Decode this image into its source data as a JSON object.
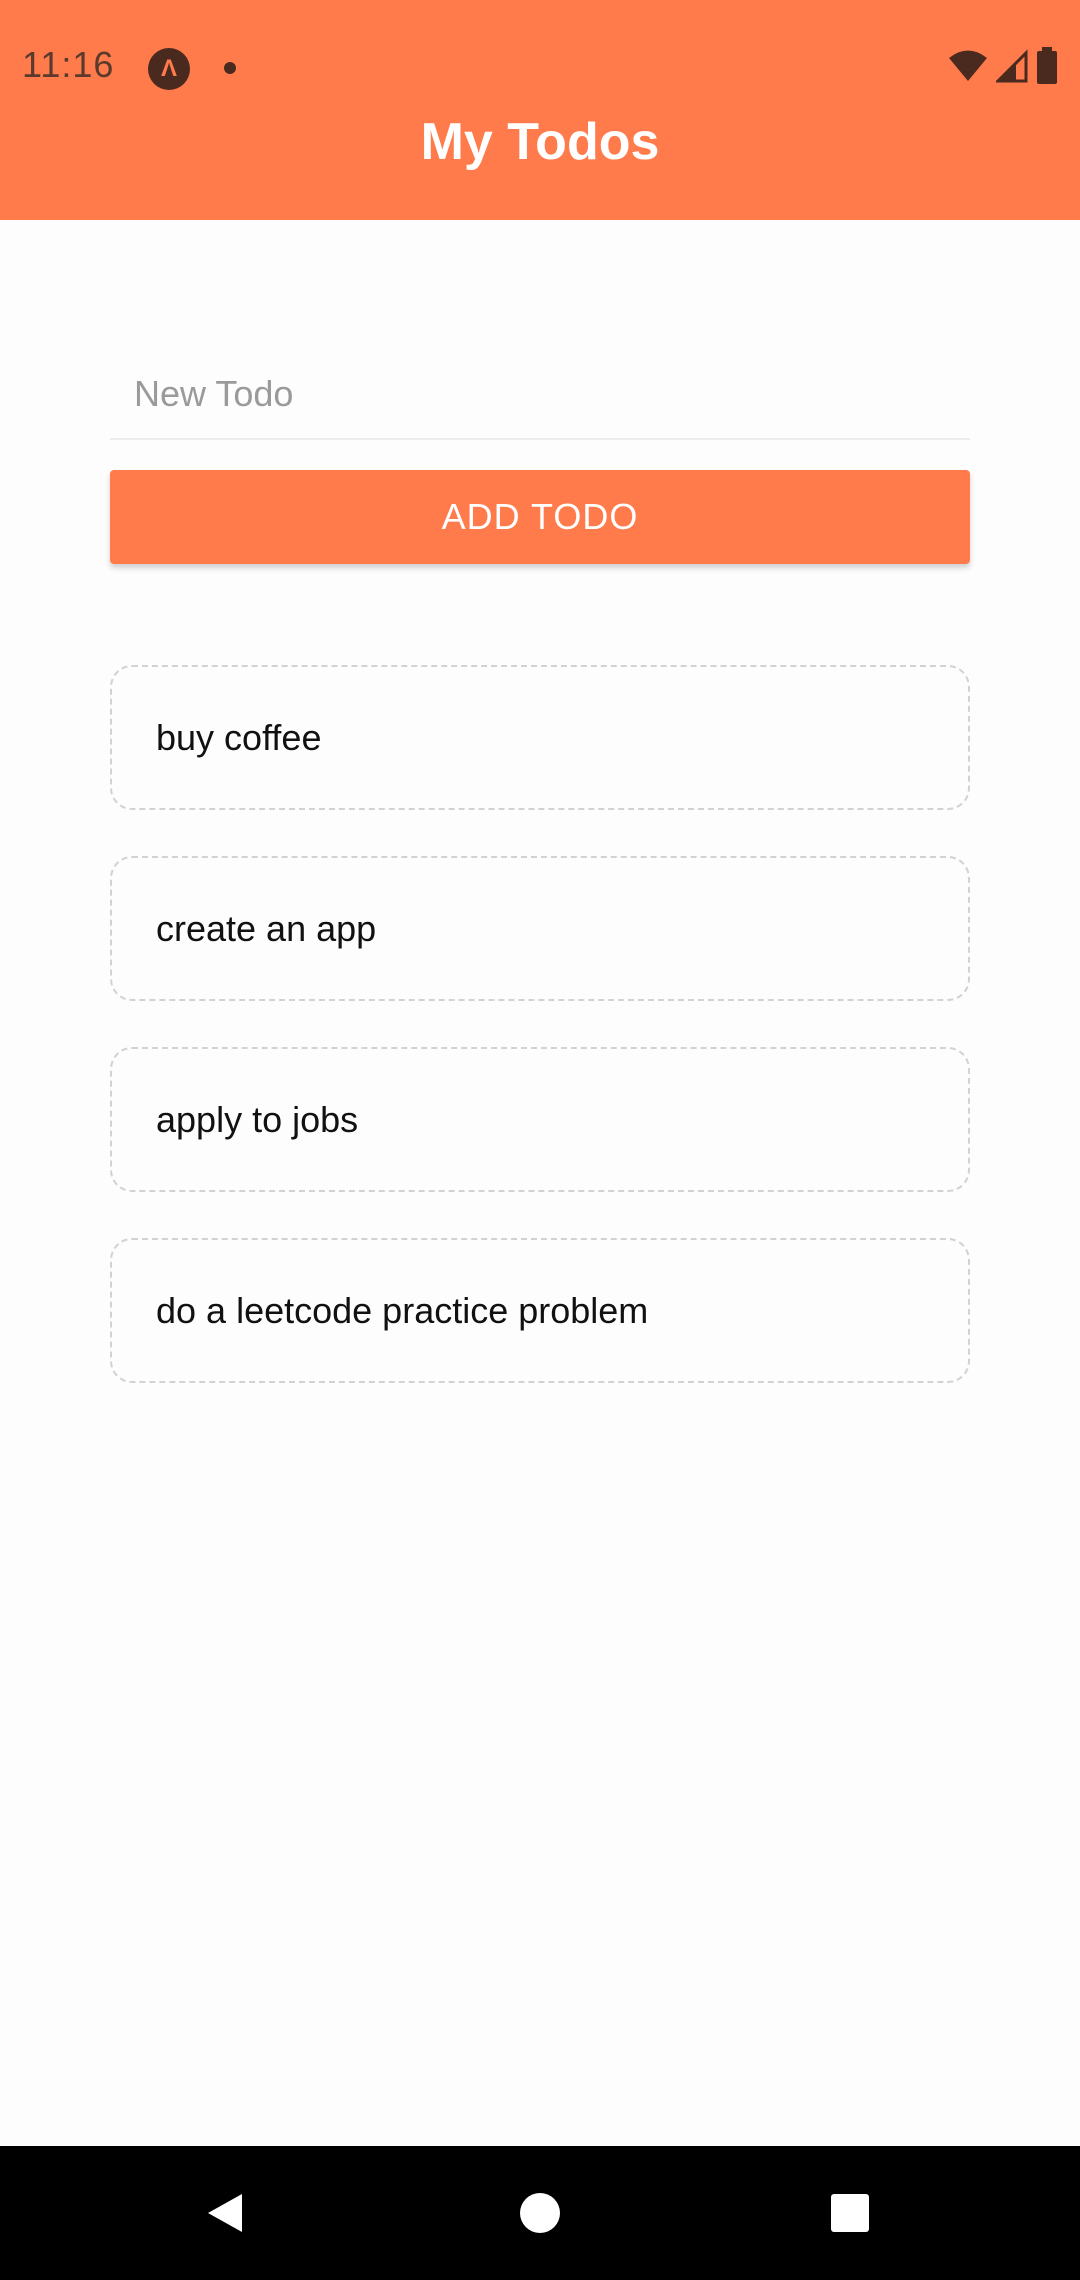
{
  "status_bar": {
    "time": "11:16",
    "app_icon_glyph": "Λ"
  },
  "header": {
    "title": "My Todos"
  },
  "input": {
    "placeholder": "New Todo",
    "value": ""
  },
  "add_button": {
    "label": "ADD TODO"
  },
  "todos": [
    {
      "text": "buy coffee"
    },
    {
      "text": "create an app"
    },
    {
      "text": "apply to jobs"
    },
    {
      "text": "do a leetcode practice problem"
    }
  ],
  "colors": {
    "accent": "#ff7b4b",
    "background": "#fdfdfd",
    "item_border": "#d2d2d2",
    "nav_bar": "#000000"
  },
  "icons": {
    "status_right": [
      "wifi-icon",
      "cell-signal-icon",
      "battery-icon"
    ],
    "nav": [
      "back-icon",
      "home-icon",
      "recents-icon"
    ]
  }
}
